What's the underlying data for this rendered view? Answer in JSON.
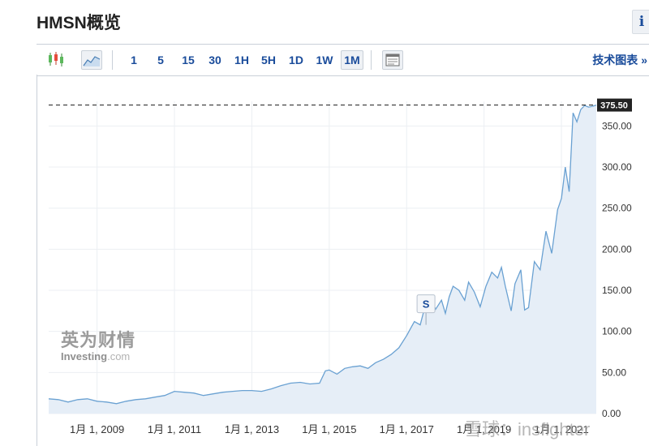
{
  "header": {
    "title": "HMSN概览",
    "info_label": "i"
  },
  "toolbar": {
    "icons": [
      "candlestick-icon",
      "area-chart-icon",
      "layout-icon"
    ],
    "intervals": [
      "1",
      "5",
      "15",
      "30",
      "1H",
      "5H",
      "1D",
      "1W",
      "1M"
    ],
    "selected_interval": "1M",
    "tech_link": "技术图表 »"
  },
  "watermark": {
    "cn": "英为财情",
    "en_a": "Investing",
    "en_b": ".com"
  },
  "xueqiu_watermark": "雪球：insfighter",
  "chart_data": {
    "type": "area",
    "title": "",
    "xlabel": "",
    "ylabel": "",
    "ylim": [
      0,
      380
    ],
    "xlim": [
      2007.75,
      2021.9
    ],
    "x_ticks": [
      2009,
      2011,
      2013,
      2015,
      2017,
      2019,
      2021
    ],
    "x_tick_labels": [
      "1月 1, 2009",
      "1月 1, 2011",
      "1月 1, 2013",
      "1月 1, 2015",
      "1月 1, 2017",
      "1月 1, 2019",
      "1月 1, 2021"
    ],
    "y_ticks": [
      0,
      50,
      100,
      150,
      200,
      250,
      300,
      350
    ],
    "y_tick_labels": [
      "0.00",
      "50.00",
      "100.00",
      "150.00",
      "200.00",
      "250.00",
      "300.00",
      "350.00"
    ],
    "last_price": 375.5,
    "last_price_label": "375.50",
    "marker": {
      "label": "S",
      "x": 2017.5,
      "y": 108
    },
    "grid": true,
    "line_color": "#6aa1d2",
    "fill_color": "#e6eef7",
    "series": [
      {
        "x": [
          2007.75,
          2008.0,
          2008.25,
          2008.5,
          2008.75,
          2009.0,
          2009.25,
          2009.5,
          2009.75,
          2010.0,
          2010.25,
          2010.5,
          2010.75,
          2011.0,
          2011.25,
          2011.5,
          2011.75,
          2012.0,
          2012.25,
          2012.5,
          2012.75,
          2013.0,
          2013.25,
          2013.5,
          2013.75,
          2014.0,
          2014.25,
          2014.5,
          2014.75,
          2014.9,
          2015.0,
          2015.2,
          2015.4,
          2015.6,
          2015.8,
          2016.0,
          2016.2,
          2016.4,
          2016.6,
          2016.8,
          2017.0,
          2017.2,
          2017.35,
          2017.5,
          2017.6,
          2017.75,
          2017.9,
          2018.0,
          2018.1,
          2018.2,
          2018.35,
          2018.5,
          2018.6,
          2018.75,
          2018.9,
          2019.05,
          2019.2,
          2019.35,
          2019.45,
          2019.55,
          2019.7,
          2019.8,
          2019.95,
          2020.05,
          2020.15,
          2020.3,
          2020.45,
          2020.6,
          2020.75,
          2020.9,
          2021.0,
          2021.1,
          2021.2,
          2021.3,
          2021.4,
          2021.5,
          2021.6,
          2021.7,
          2021.8,
          2021.9
        ],
        "y": [
          18,
          17,
          14,
          17,
          18,
          15,
          14,
          12,
          15,
          17,
          18,
          20,
          22,
          27,
          26,
          25,
          22,
          24,
          26,
          27,
          28,
          28,
          27,
          30,
          34,
          37,
          38,
          36,
          37,
          52,
          53,
          48,
          55,
          57,
          58,
          55,
          62,
          66,
          72,
          80,
          95,
          112,
          108,
          135,
          143,
          127,
          138,
          122,
          142,
          155,
          150,
          138,
          160,
          148,
          130,
          155,
          172,
          165,
          178,
          155,
          125,
          158,
          175,
          126,
          129,
          185,
          175,
          222,
          195,
          248,
          262,
          300,
          270,
          366,
          355,
          370,
          375,
          373,
          374,
          375.5
        ]
      }
    ]
  }
}
